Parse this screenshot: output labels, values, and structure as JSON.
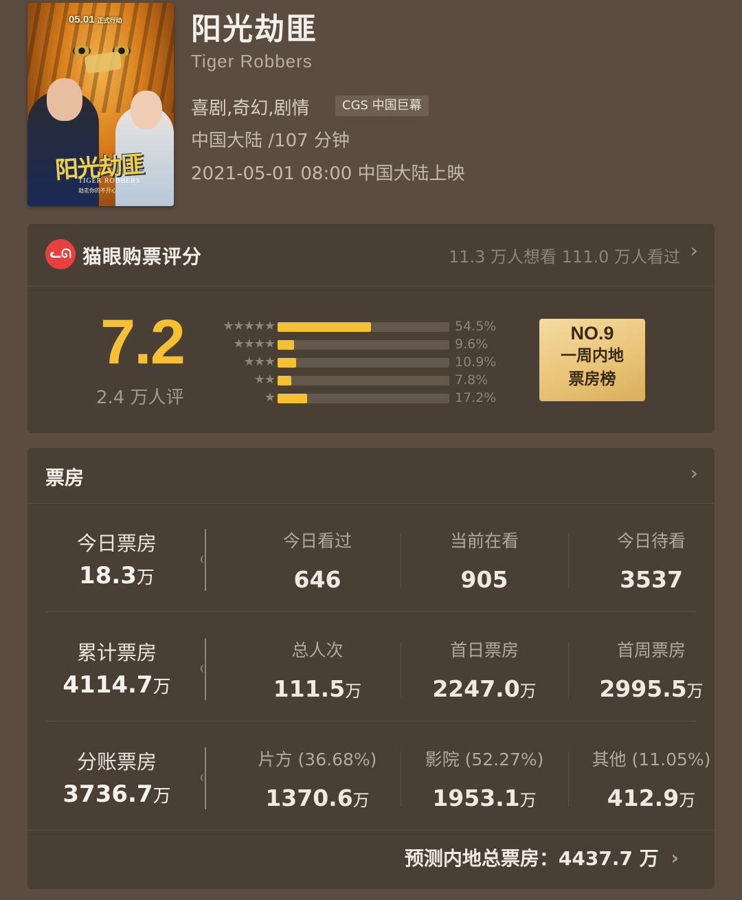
{
  "movie": {
    "title": "阳光劫匪",
    "english_title": "Tiger Robbers",
    "genres": "喜剧,奇幻,剧情",
    "format_badge": "CGS 中国巨幕",
    "region_duration": "中国大陆 /107 分钟",
    "release": "2021-05-01 08:00 中国大陆上映",
    "poster": {
      "date": "05.01",
      "date_tag": "正式行动",
      "title": "阳光劫匪",
      "subtitle": "TIGER ROBBERS",
      "tagline": "劫走你的不开心"
    }
  },
  "rating": {
    "logo_text": "ᓚᘏ",
    "label": "猫眼购票评分",
    "stats": "11.3 万人想看  111.0 万人看过",
    "score": "7.2",
    "count": "2.4 万人评",
    "distribution": [
      {
        "stars": "★★★★★",
        "percent": 54.5,
        "label": "54.5%"
      },
      {
        "stars": "★★★★",
        "percent": 9.6,
        "label": "9.6%"
      },
      {
        "stars": "★★★",
        "percent": 10.9,
        "label": "10.9%"
      },
      {
        "stars": "★★",
        "percent": 7.8,
        "label": "7.8%"
      },
      {
        "stars": "★",
        "percent": 17.2,
        "label": "17.2%"
      }
    ],
    "rank": {
      "no": "NO.9",
      "line1": "一周内地",
      "line2": "票房榜"
    },
    "accent_color": "#f6c033"
  },
  "box_office": {
    "title": "票房",
    "rows": [
      {
        "main_label": "今日票房",
        "main_value": "18.3",
        "main_unit": "万",
        "cells": [
          {
            "label": "今日看过",
            "value": "646",
            "unit": ""
          },
          {
            "label": "当前在看",
            "value": "905",
            "unit": ""
          },
          {
            "label": "今日待看",
            "value": "3537",
            "unit": ""
          }
        ]
      },
      {
        "main_label": "累计票房",
        "main_value": "4114.7",
        "main_unit": "万",
        "cells": [
          {
            "label": "总人次",
            "value": "111.5",
            "unit": "万"
          },
          {
            "label": "首日票房",
            "value": "2247.0",
            "unit": "万"
          },
          {
            "label": "首周票房",
            "value": "2995.5",
            "unit": "万"
          }
        ]
      },
      {
        "main_label": "分账票房",
        "main_value": "3736.7",
        "main_unit": "万",
        "cells": [
          {
            "label": "片方 (36.68%)",
            "value": "1370.6",
            "unit": "万"
          },
          {
            "label": "影院 (52.27%)",
            "value": "1953.1",
            "unit": "万"
          },
          {
            "label": "其他 (11.05%)",
            "value": "412.9",
            "unit": "万"
          }
        ]
      }
    ],
    "forecast": "预测内地总票房：4437.7 万"
  },
  "icons": {
    "chevron": "›"
  }
}
